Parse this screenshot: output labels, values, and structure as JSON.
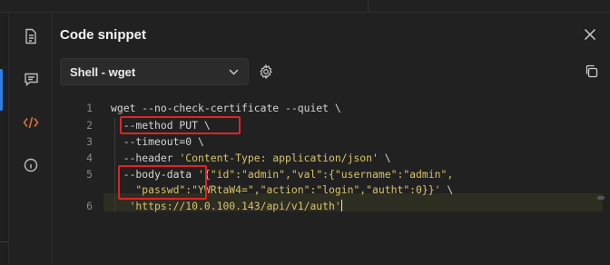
{
  "panel": {
    "title": "Code snippet"
  },
  "rail": {
    "icons": [
      "document-icon",
      "comment-icon",
      "code-icon",
      "info-icon"
    ],
    "active": "code-icon",
    "accent": "#e0743a"
  },
  "toolbar": {
    "language": "Shell - wget"
  },
  "code": {
    "line_numbers": [
      "1",
      "2",
      "3",
      "4",
      "5",
      "",
      "6"
    ],
    "lines": {
      "l1": "wget --no-check-certificate --quiet \\",
      "l2": "  --method PUT \\",
      "l3": "  --timeout=0 \\",
      "l4a": "  --header ",
      "l4b": "'Content-Type: application/json'",
      "l4c": " \\",
      "l5a": "  --body-data ",
      "l5b": "'{\"id\":\"admin\",\"val\":{\"username\":\"admin\",",
      "l5c": "    \"passwd\":\"YWRtaW4=\",\"action\":\"login\",\"autht\":0}}'",
      "l5d": " \\",
      "l6": "   'https://10.0.100.143/api/v1/auth'"
    }
  },
  "colors": {
    "highlight": "#e02424",
    "string": "#d9c36a",
    "text": "#d4d4d4"
  }
}
